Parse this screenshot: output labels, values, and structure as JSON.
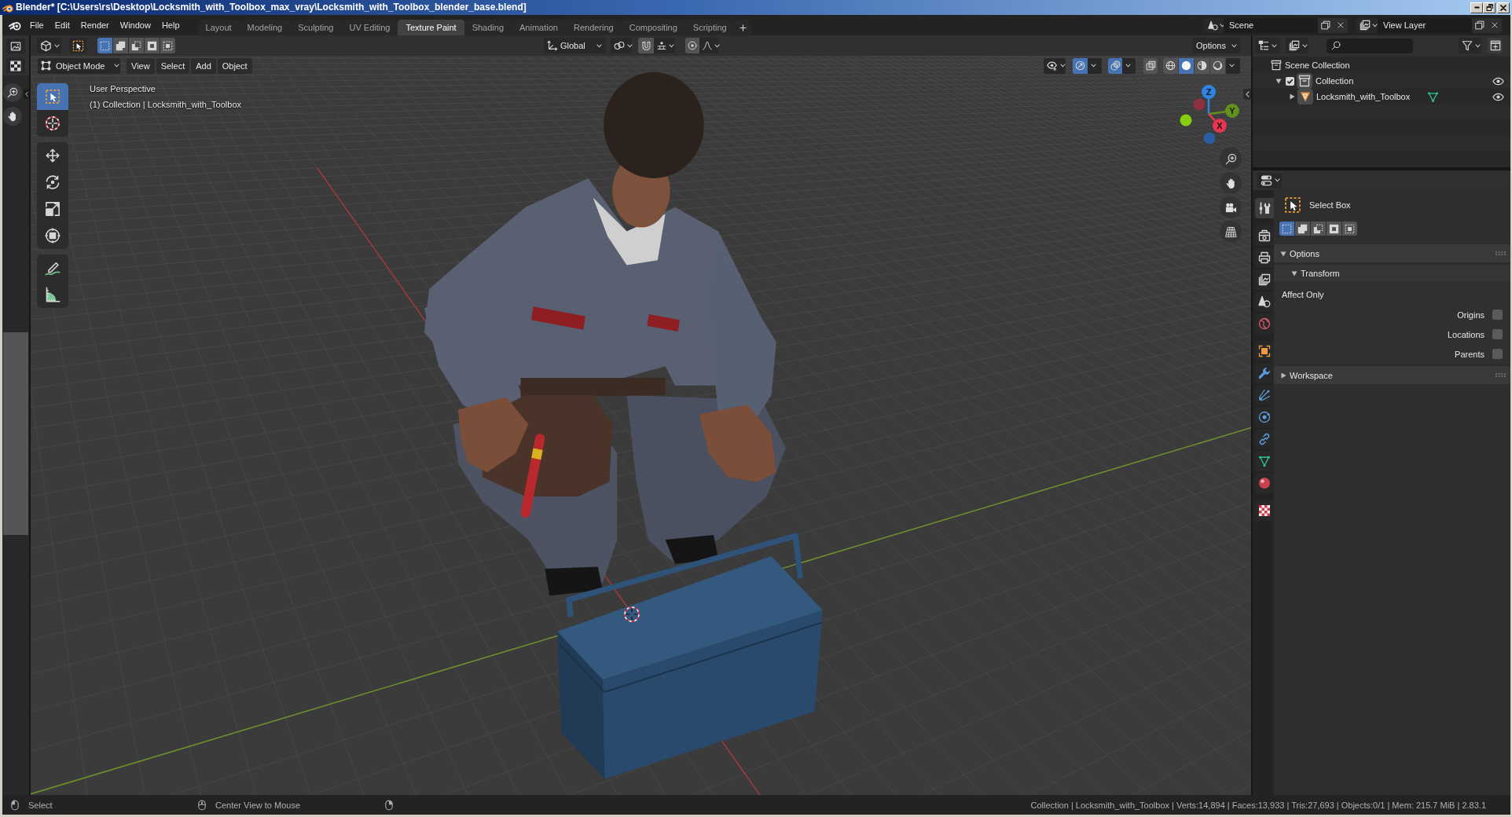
{
  "window": {
    "title": "Blender* [C:\\Users\\rs\\Desktop\\Locksmith_with_Toolbox_max_vray\\Locksmith_with_Toolbox_blender_base.blend]"
  },
  "menu_bar": {
    "menus": [
      "File",
      "Edit",
      "Render",
      "Window",
      "Help"
    ],
    "workspaces": [
      {
        "label": "Layout",
        "selected": false
      },
      {
        "label": "Modeling",
        "selected": false
      },
      {
        "label": "Sculpting",
        "selected": false
      },
      {
        "label": "UV Editing",
        "selected": false
      },
      {
        "label": "Texture Paint",
        "selected": true
      },
      {
        "label": "Shading",
        "selected": false
      },
      {
        "label": "Animation",
        "selected": false
      },
      {
        "label": "Rendering",
        "selected": false
      },
      {
        "label": "Compositing",
        "selected": false
      },
      {
        "label": "Scripting",
        "selected": false
      }
    ],
    "scene": {
      "value": "Scene"
    },
    "view_layer": {
      "value": "View Layer"
    }
  },
  "viewport": {
    "tool_header": {
      "select_modes": [
        {
          "selected": true
        },
        {
          "selected": false
        },
        {
          "selected": false
        },
        {
          "selected": false
        },
        {
          "selected": false
        }
      ],
      "orientation": "Global",
      "snap": {
        "on": false
      },
      "proportional_editing": {
        "on": false
      },
      "options": "Options"
    },
    "header": {
      "mode": "Object Mode",
      "menus": [
        "View",
        "Select",
        "Add",
        "Object"
      ],
      "gizmos": {
        "on": true
      },
      "overlays": {
        "on": true
      },
      "xray": {
        "on": false
      },
      "shading_modes": [
        {
          "selected": false
        },
        {
          "selected": true
        },
        {
          "selected": false
        },
        {
          "selected": false
        }
      ]
    },
    "toolbar": [
      {
        "selected": true
      },
      {
        "selected": false
      },
      {
        "selected": false
      },
      {
        "selected": false
      },
      {
        "selected": false
      },
      {
        "selected": false
      },
      {
        "selected": false
      },
      {
        "selected": false
      }
    ],
    "info": [
      "User Perspective",
      "(1) Collection | Locksmith_with_Toolbox"
    ],
    "gizmo": {
      "handles": [
        {
          "label": "Z",
          "color": "#2f84e3"
        },
        {
          "color": "#8e3040"
        },
        {
          "label": "Y",
          "color": "#62901f"
        },
        {
          "color": "#86cc10"
        },
        {
          "label": "X",
          "color": "#e8354f"
        },
        {
          "color": "#2b5e9e"
        }
      ]
    }
  },
  "outliner": {
    "items": [
      {
        "kind": "scene_collection",
        "label": "Scene Collection",
        "children": [
          {
            "kind": "collection",
            "label": "Collection",
            "expanded": true,
            "checked": true,
            "visible": true,
            "children": [
              {
                "kind": "object",
                "label": "Locksmith_with_Toolbox",
                "expanded": false,
                "visible": true
              }
            ]
          }
        ]
      }
    ]
  },
  "properties": {
    "tabs": [
      {
        "selected": true
      },
      {
        "selected": false
      },
      {
        "selected": false
      },
      {
        "selected": false
      },
      {
        "selected": false
      },
      {
        "selected": false
      },
      {
        "selected": false
      },
      {
        "selected": false
      },
      {
        "selected": false
      },
      {
        "selected": false
      },
      {
        "selected": false
      },
      {
        "selected": false
      },
      {
        "selected": false
      },
      {
        "selected": false
      }
    ],
    "tool": {
      "name": "Select Box",
      "select_modes": [
        {
          "selected": true
        },
        {
          "selected": false
        },
        {
          "selected": false
        },
        {
          "selected": false
        },
        {
          "selected": false
        }
      ]
    },
    "panels": [
      {
        "title": "Options",
        "expanded": true,
        "subpanels": [
          {
            "title": "Transform",
            "expanded": true,
            "label": "Affect Only",
            "options": [
              {
                "label": "Origins",
                "checked": false
              },
              {
                "label": "Locations",
                "checked": false
              },
              {
                "label": "Parents",
                "checked": false
              }
            ]
          }
        ]
      },
      {
        "title": "Workspace",
        "expanded": false
      }
    ]
  },
  "status_bar": {
    "hints": [
      "Select",
      "Center View to Mouse"
    ],
    "stats": "Collection | Locksmith_with_Toolbox | Verts:14,894 | Faces:13,933 | Tris:27,693 | Objects:0/1 | Mem: 215.7 MiB | 2.83.1"
  }
}
